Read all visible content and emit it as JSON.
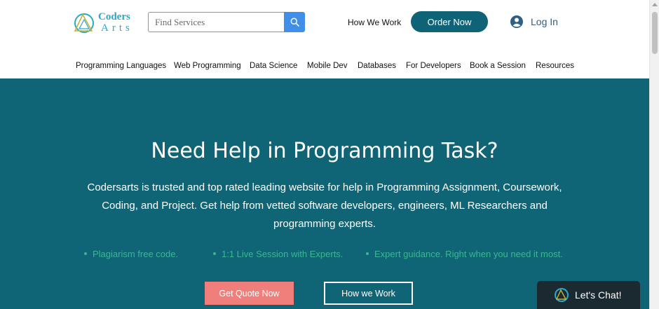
{
  "header": {
    "logo": {
      "line1": "Coders",
      "line2": "Arts"
    },
    "search": {
      "placeholder": "Find Services",
      "value": ""
    },
    "how_we_work": "How We Work",
    "order_now": "Order Now",
    "log_in": "Log In"
  },
  "nav": {
    "items": [
      {
        "label": "Programming Languages"
      },
      {
        "label": "Web Programming"
      },
      {
        "label": "Data Science"
      },
      {
        "label": "Mobile Dev"
      },
      {
        "label": "Databases"
      },
      {
        "label": "For Developers"
      },
      {
        "label": "Book a Session"
      },
      {
        "label": "Resources"
      }
    ]
  },
  "hero": {
    "title": "Need Help in Programming Task?",
    "description": "Codersarts is trusted and top rated leading website for help in Programming Assignment, Coursework, Coding, and Project. Get help from vetted software developers, engineers, ML Researchers and programming experts.",
    "bullets": [
      "Plagiarism free code.",
      "1:1 Live Session with Experts.",
      "Expert guidance. Right when you need it most."
    ],
    "quote_button": "Get Quote Now",
    "how_button": "How we Work"
  },
  "chat": {
    "label": "Let's Chat!"
  },
  "colors": {
    "brand_teal": "#0f6476",
    "accent_green": "#3bb794",
    "quote_coral": "#f07f7c",
    "search_blue": "#3f8ee7"
  },
  "icons": {
    "search": "search-icon",
    "user": "user-icon",
    "chat": "chat-icon",
    "logo": "logo-icon"
  }
}
